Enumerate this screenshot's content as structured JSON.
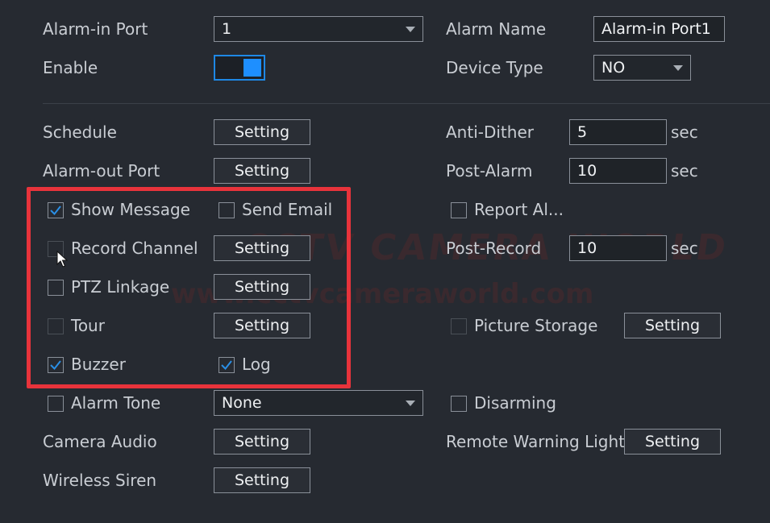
{
  "alarm_in_port": {
    "label": "Alarm-in Port",
    "value": "1"
  },
  "alarm_name": {
    "label": "Alarm Name",
    "value": "Alarm-in Port1"
  },
  "enable": {
    "label": "Enable",
    "on": true
  },
  "device_type": {
    "label": "Device Type",
    "value": "NO"
  },
  "schedule": {
    "label": "Schedule",
    "button": "Setting"
  },
  "anti_dither": {
    "label": "Anti-Dither",
    "value": "5",
    "unit": "sec"
  },
  "alarm_out_port": {
    "label": "Alarm-out Port",
    "button": "Setting"
  },
  "post_alarm": {
    "label": "Post-Alarm",
    "value": "10",
    "unit": "sec"
  },
  "show_message": {
    "label": "Show Message",
    "checked": true
  },
  "send_email": {
    "label": "Send Email",
    "checked": false
  },
  "report_alarm": {
    "label": "Report Al...",
    "checked": false
  },
  "record_channel": {
    "label": "Record Channel",
    "checked": false,
    "button": "Setting"
  },
  "post_record": {
    "label": "Post-Record",
    "value": "10",
    "unit": "sec"
  },
  "ptz_linkage": {
    "label": "PTZ Linkage",
    "checked": false,
    "button": "Setting"
  },
  "tour": {
    "label": "Tour",
    "checked": false,
    "button": "Setting"
  },
  "picture_storage": {
    "label": "Picture Storage",
    "checked": false,
    "button": "Setting"
  },
  "buzzer": {
    "label": "Buzzer",
    "checked": true
  },
  "log": {
    "label": "Log",
    "checked": true
  },
  "alarm_tone": {
    "label": "Alarm Tone",
    "checked": false,
    "value": "None"
  },
  "disarming": {
    "label": "Disarming",
    "checked": false
  },
  "camera_audio": {
    "label": "Camera Audio",
    "button": "Setting"
  },
  "remote_warning_light": {
    "label": "Remote Warning Light",
    "button": "Setting"
  },
  "wireless_siren": {
    "label": "Wireless Siren",
    "button": "Setting"
  },
  "watermark": {
    "line1": "CCTV CAMERA WORLD",
    "line2": "www.cctvcameraworld.com"
  },
  "colors": {
    "accent": "#1e8fff",
    "highlight": "#e8333b",
    "background": "#262a31"
  },
  "icons": {
    "checkmark": "checkmark-icon",
    "dropdown": "chevron-down-icon",
    "cursor": "mouse-cursor-icon"
  }
}
